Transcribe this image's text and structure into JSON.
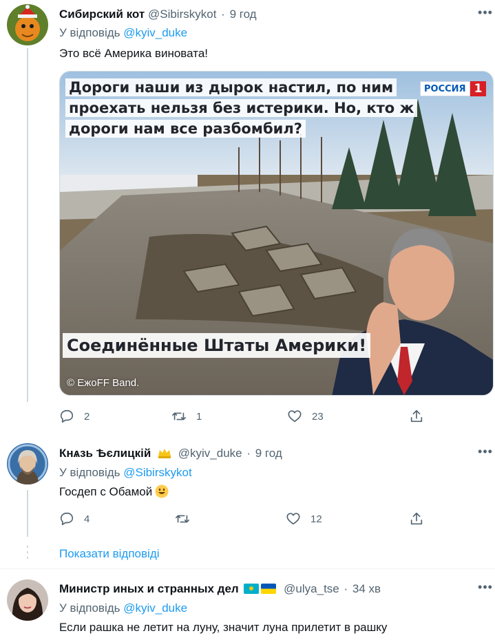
{
  "tweets": [
    {
      "name": "Сибирский кот",
      "handle": "@Sibirskykot",
      "time": "9 год",
      "reply_prefix": "У відповідь",
      "reply_to": "@kyiv_duke",
      "text": "Это всё Америка виновата!",
      "actions": {
        "replies": "2",
        "retweets": "1",
        "likes": "23"
      },
      "media": {
        "caption_top": "Дороги наши из дырок настил, по ним проехать нельзя без истерики. Но, кто ж дороги нам все разбомбил?",
        "caption_bottom": "Соединённые Штаты Америки!",
        "logo_text": "РОССИЯ",
        "logo_number": "1",
        "watermark": "© ЕжоFF Band."
      }
    },
    {
      "name": "Кнѧзь Ѣєлицкій",
      "handle": "@kyiv_duke",
      "time": "9 год",
      "reply_prefix": "У відповідь",
      "reply_to": "@Sibirskykot",
      "text": "Госдеп с Обамой",
      "actions": {
        "replies": "4",
        "retweets": "",
        "likes": "12"
      }
    },
    {
      "name": "Министр иных и странных дел",
      "handle": "@ulya_tse",
      "time": "34 хв",
      "reply_prefix": "У відповідь",
      "reply_to": "@kyiv_duke",
      "text": "Если рашка не летит на луну, значит луна прилетит в рашку"
    }
  ],
  "show_replies": "Показати відповіді",
  "dot": "·",
  "colors": {
    "accent": "#1d9bf0",
    "secondary": "#536471",
    "line": "#cfd9de"
  },
  "icons": [
    "more-icon",
    "reply-icon",
    "retweet-icon",
    "like-icon",
    "share-icon",
    "crown-icon",
    "kazakhstan-flag-icon",
    "ukraine-flag-icon",
    "smile-emoji-icon"
  ]
}
